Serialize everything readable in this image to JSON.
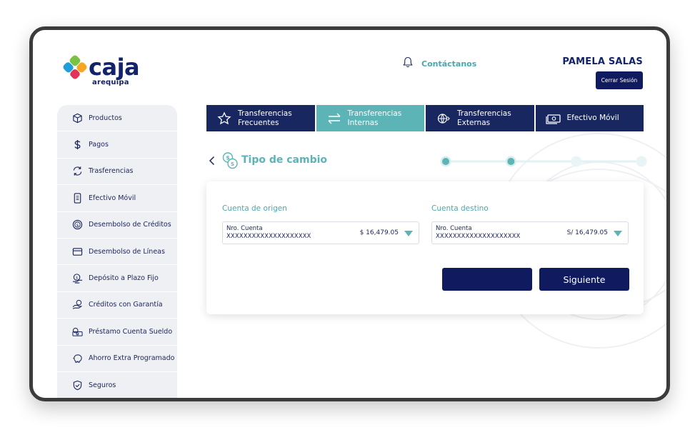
{
  "brand": {
    "name": "caja",
    "subtitle": "arequipa",
    "colors": {
      "mark_tl": "#7cc242",
      "mark_tr": "#f6a623",
      "mark_bl": "#1f9ed8",
      "mark_br": "#e2315a"
    }
  },
  "header": {
    "contact_label": "Contáctanos",
    "contact_icon": "bell-icon",
    "user_name": "PAMELA SALAS",
    "logout_label": "Cerrar Sesión"
  },
  "sidebar": {
    "items": [
      {
        "label": "Productos",
        "icon": "box-icon"
      },
      {
        "label": "Pagos",
        "icon": "dollar-icon"
      },
      {
        "label": "Trasferencias",
        "icon": "refresh-icon"
      },
      {
        "label": "Efectivo Móvil",
        "icon": "phone-cash-icon"
      },
      {
        "label": "Desembolso de Créditos",
        "icon": "coin-icon"
      },
      {
        "label": "Desembolso de Líneas",
        "icon": "card-icon"
      },
      {
        "label": "Depósito a Plazo Fijo",
        "icon": "savings-icon"
      },
      {
        "label": "Créditos con Garantía",
        "icon": "hand-coin-icon"
      },
      {
        "label": "Préstamo Cuenta Sueldo",
        "icon": "cash-stack-icon"
      },
      {
        "label": "Ahorro Extra Programado",
        "icon": "piggy-bank-icon"
      },
      {
        "label": "Seguros",
        "icon": "shield-icon"
      }
    ]
  },
  "tabs": [
    {
      "label": "Transferencias Frecuentes",
      "icon": "star-icon",
      "active": false
    },
    {
      "label": "Transferencias Internas",
      "icon": "swap-arrows-icon",
      "active": true
    },
    {
      "label": "Transferencias Externas",
      "icon": "globe-icon",
      "active": false
    },
    {
      "label": "Efectivo Móvil",
      "icon": "money-icon",
      "active": false
    }
  ],
  "step": {
    "title": "Tipo de cambio",
    "current": 2,
    "total": 4
  },
  "form": {
    "origin": {
      "label": "Cuenta de origen",
      "key": "Nro. Cuenta",
      "account": "XXXXXXXXXXXXXXXXXXXX",
      "amount": "$ 16,479.05"
    },
    "destination": {
      "label": "Cuenta destino",
      "key": "Nro. Cuenta",
      "account": "XXXXXXXXXXXXXXXXXXXX",
      "amount": "S/ 16,479.05"
    },
    "prev_label": "",
    "next_label": "Siguiente"
  },
  "colors": {
    "navy": "#0f1b5e",
    "teal": "#5db4b6",
    "sidebar_bg": "#eef0f3"
  }
}
